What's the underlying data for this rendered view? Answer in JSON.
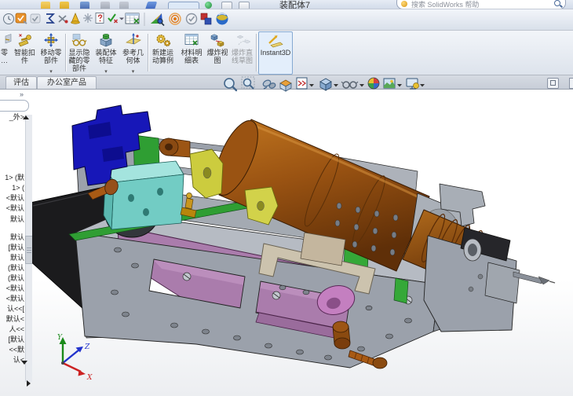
{
  "window": {
    "title": "装配体7",
    "search_placeholder": "搜索 SolidWorks 帮助"
  },
  "toolbar": {
    "icons": [
      "design-binder-clock",
      "design-checker",
      "check-readonly",
      "equations",
      "no-external-references",
      "alert-cone",
      "constraint-crosshair",
      "help-document",
      "verification-check",
      "flyout-caret",
      "excel-bom-table",
      "photoview-360",
      "motion-manager",
      "circled-check",
      "toolbox",
      "edrawings-sphere"
    ]
  },
  "ribbon": {
    "buttons": [
      {
        "name": "insert-component-partial",
        "label": "零\n…"
      },
      {
        "name": "smart-fasteners",
        "label": "智能扣\n件"
      },
      {
        "name": "move-component",
        "label": "移动零\n部件"
      },
      {
        "name": "show-hidden-components",
        "label": "显示隐\n藏的零\n部件"
      },
      {
        "name": "assembly-features",
        "label": "装配体\n特征"
      },
      {
        "name": "reference-geometry",
        "label": "参考几\n何体"
      },
      {
        "name": "new-motion-study",
        "label": "新建运\n动算例"
      },
      {
        "name": "bill-of-materials",
        "label": "材料明\n细表"
      },
      {
        "name": "exploded-view",
        "label": "爆炸视\n图"
      },
      {
        "name": "explode-line-sketch",
        "label": "爆炸直\n线草图"
      },
      {
        "name": "instant3d",
        "label": "Instant3D"
      }
    ]
  },
  "tabs": {
    "items": [
      "评估",
      "办公室产品"
    ]
  },
  "headsup": {
    "icons": [
      "zoom-to-fit",
      "zoom-to-area",
      "view-selector",
      "section-view",
      "view-orientation",
      "display-style",
      "hide-show-items",
      "edit-appearance",
      "apply-scene",
      "view-settings"
    ]
  },
  "tree": {
    "expand_chevron": "»",
    "items": [
      "_外>",
      "1> (默",
      "1> (",
      "<默认",
      "<默认",
      "默认",
      "默认",
      "[默认",
      "默认",
      "(默认",
      "(默认",
      "<默认",
      "<默认",
      "认<<[",
      "默认<",
      "人<<",
      "[默认",
      "<<默",
      "认<"
    ]
  },
  "triad": {
    "x_label": "X",
    "y_label": "Y",
    "z_label": "Z"
  },
  "model": {
    "parts": [
      {
        "name": "motor-cylinder",
        "color": "#9A5312"
      },
      {
        "name": "drive-belt",
        "color": "#AA7CAC"
      },
      {
        "name": "pulley-pink",
        "color": "#C47FC0"
      },
      {
        "name": "bracket-blue",
        "color": "#1717B8"
      },
      {
        "name": "block-cyan",
        "color": "#72CCC4"
      },
      {
        "name": "plate-green",
        "color": "#2F9E33"
      },
      {
        "name": "clamp-yellow",
        "color": "#CCCC3E"
      },
      {
        "name": "frame-gray",
        "color": "#9BA1AB"
      },
      {
        "name": "wedge-black",
        "color": "#1B1B1D"
      },
      {
        "name": "handle-tan",
        "color": "#CCC3AE"
      },
      {
        "name": "screw-brown",
        "color": "#A85A14"
      },
      {
        "name": "fitting-gold",
        "color": "#C8961E"
      }
    ]
  }
}
